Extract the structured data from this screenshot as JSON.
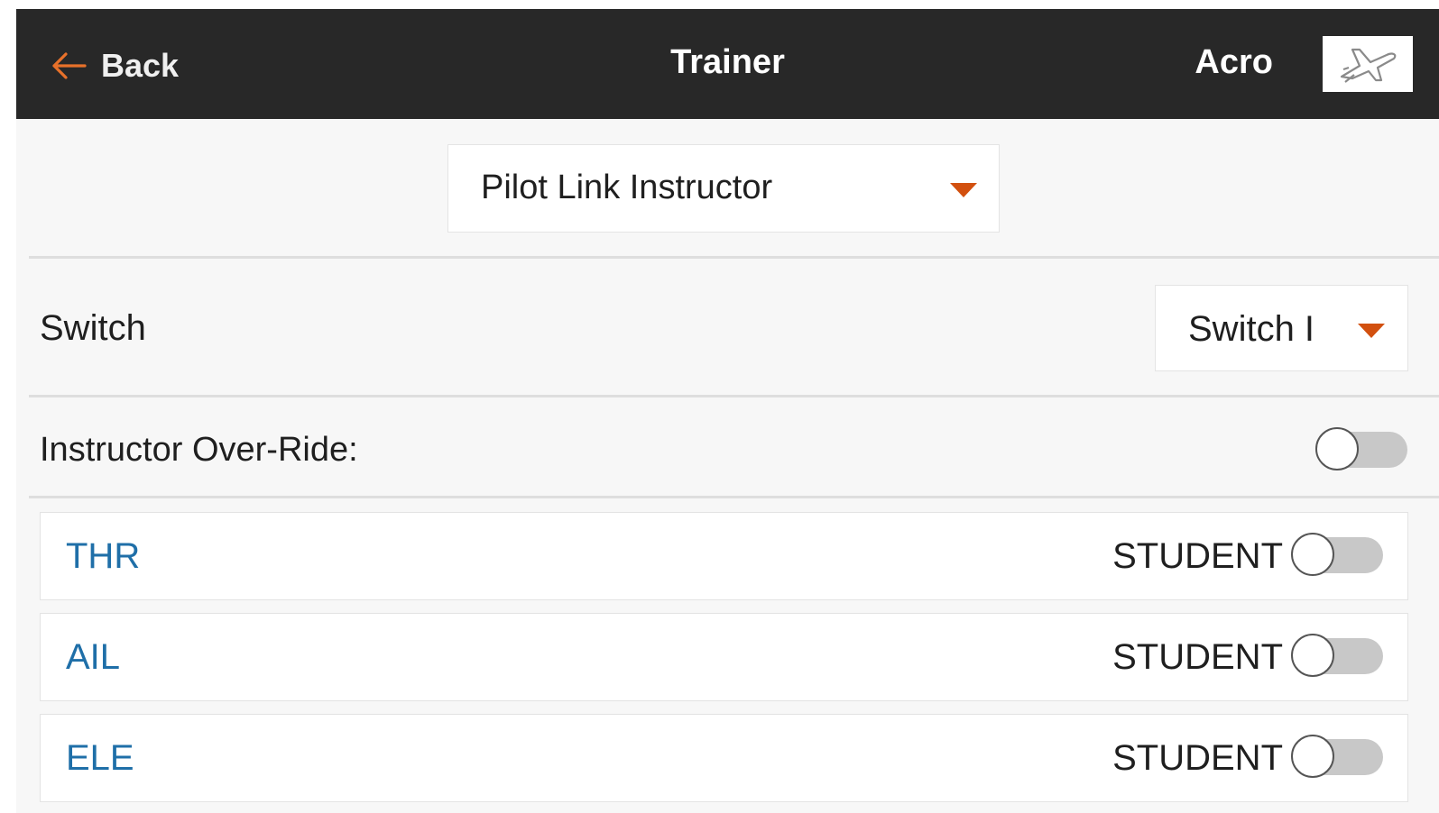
{
  "header": {
    "back_label": "Back",
    "title": "Trainer",
    "model_name": "Acro",
    "model_icon": "airplane-icon"
  },
  "trainer_mode": {
    "selected": "Pilot Link Instructor"
  },
  "switch": {
    "label": "Switch",
    "selected": "Switch I"
  },
  "override": {
    "label": "Instructor Over-Ride:",
    "enabled": false
  },
  "channels": [
    {
      "name": "THR",
      "mode": "STUDENT",
      "enabled": false
    },
    {
      "name": "AIL",
      "mode": "STUDENT",
      "enabled": false
    },
    {
      "name": "ELE",
      "mode": "STUDENT",
      "enabled": false
    }
  ],
  "colors": {
    "header_bg": "#282828",
    "accent": "#d2500f",
    "channel_text": "#1f6fa8"
  }
}
